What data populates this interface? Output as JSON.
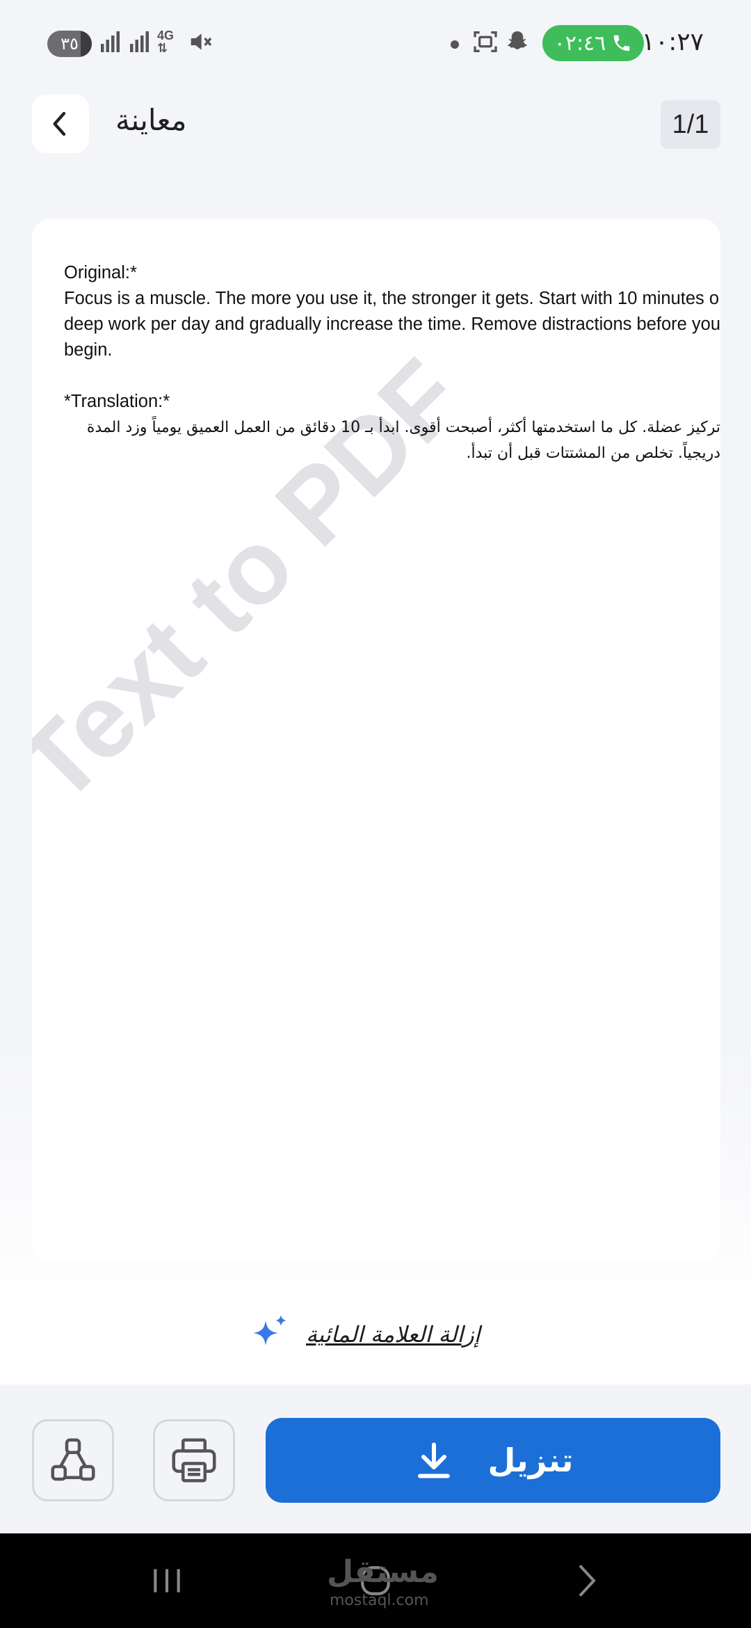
{
  "status_bar": {
    "time": "١٠:٢٧",
    "call_duration": "٠٢:٤٦",
    "battery": "٣٥",
    "network": "4G",
    "icons": [
      "phone-icon",
      "snapchat-icon",
      "screenshot-icon",
      "dot-icon",
      "mute-icon",
      "signal-icon",
      "network-4g-icon"
    ]
  },
  "header": {
    "title": "معاينة",
    "page_counter": "1/1"
  },
  "document": {
    "lines_en": [
      "Original:*",
      "Focus is a muscle. The more you use it, the stronger it gets. Start with 10 minutes o",
      "deep work per day and gradually increase the time. Remove distractions before you",
      "begin."
    ],
    "translation_label": "*Translation:*",
    "lines_ar": [
      "تركيز عضلة. كل ما استخدمتها أكثر، أصبحت أقوى. ابدأ بـ 10 دقائق من العمل العميق يومياً وزد المدة",
      "دريجياً. تخلص من المشتتات قبل أن تبدأ."
    ],
    "watermark": "Text to PDF"
  },
  "remove_watermark": {
    "label": "إزالة العلامة المائية"
  },
  "actions": {
    "download_label": "تنزيل"
  },
  "nav_bar": {
    "overlay_text": "مستقل",
    "overlay_subtext": "mostaql.com"
  },
  "colors": {
    "primary": "#1c6fd6",
    "call_green": "#3fbd5a",
    "sparkle": "#3a78e6"
  }
}
